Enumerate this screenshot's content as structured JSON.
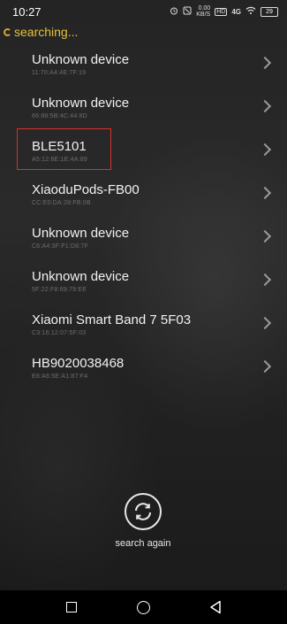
{
  "status_bar": {
    "time": "10:27",
    "alarm_icon": "alarm-icon",
    "mute_icon": "mute-icon",
    "speed": "0.00",
    "speed_unit": "KB/S",
    "hd_badge": "HD",
    "network": "4G",
    "wifi_icon": "wifi-icon",
    "battery": "29"
  },
  "search": {
    "status_text": "searching...",
    "again_label": "search again"
  },
  "devices": [
    {
      "name": "Unknown device",
      "mac": "11:70:A4:4E:7F:19"
    },
    {
      "name": "Unknown device",
      "mac": "66:88:5B:4C:44:8D"
    },
    {
      "name": "BLE5101",
      "mac": "A5:12:6E:1E:4A:89"
    },
    {
      "name": "XiaoduPods-FB00",
      "mac": "CC:E0:DA:28:FB:0B"
    },
    {
      "name": "Unknown device",
      "mac": "C6:A4:3F:F1:D8:7F"
    },
    {
      "name": "Unknown device",
      "mac": "5F:22:F8:69:79:EE"
    },
    {
      "name": "Xiaomi Smart Band 7 5F03",
      "mac": "C3:16:12:07:5F:03"
    },
    {
      "name": "HB9020038468",
      "mac": "E8:A6:5E:A1:87:F4"
    }
  ],
  "colors": {
    "accent_text": "#e6c23a",
    "highlight": "#d9302c"
  }
}
